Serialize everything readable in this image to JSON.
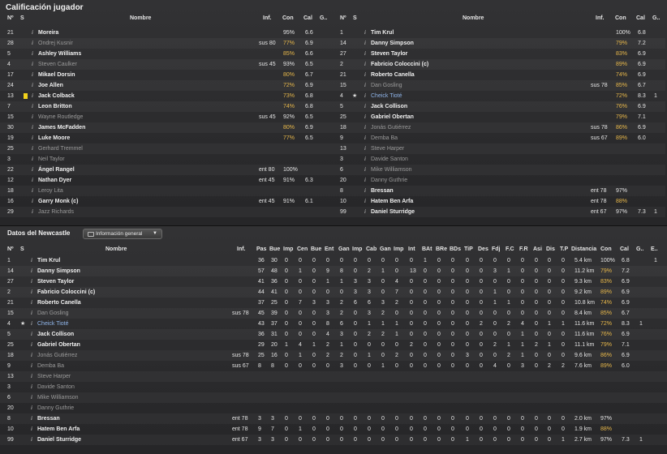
{
  "ratings": {
    "title": "Calificación jugador",
    "headers": {
      "num": "Nº",
      "s": "S",
      "name": "Nombre",
      "inf": "Inf.",
      "con": "Con",
      "cal": "Cal",
      "g": "G.."
    },
    "left": [
      {
        "n": "21",
        "name": "Moreira",
        "style": "normal",
        "inf": "",
        "con": "95%",
        "conc": "wht",
        "cal": "6.6"
      },
      {
        "n": "28",
        "name": "Ondrej Kusnir",
        "style": "dim",
        "inf": "sus 80",
        "con": "77%",
        "conc": "gold",
        "cal": "6.9"
      },
      {
        "n": "5",
        "name": "Ashley Williams",
        "style": "normal",
        "inf": "",
        "con": "85%",
        "conc": "gold",
        "cal": "6.6"
      },
      {
        "n": "4",
        "name": "Steven Caulker",
        "style": "dim",
        "inf": "sus 45",
        "con": "93%",
        "conc": "wht",
        "cal": "6.5"
      },
      {
        "n": "17",
        "name": "Mikael Dorsin",
        "style": "normal",
        "inf": "",
        "con": "80%",
        "conc": "gold",
        "cal": "6.7"
      },
      {
        "n": "24",
        "name": "Joe Allen",
        "style": "normal",
        "inf": "",
        "con": "72%",
        "conc": "gold",
        "cal": "6.9"
      },
      {
        "n": "13",
        "name": "Jack Colback",
        "style": "normal",
        "inf": "",
        "con": "73%",
        "conc": "gold",
        "cal": "6.8",
        "card": true
      },
      {
        "n": "7",
        "name": "Leon Britton",
        "style": "normal",
        "inf": "",
        "con": "74%",
        "conc": "gold",
        "cal": "6.8"
      },
      {
        "n": "15",
        "name": "Wayne Routledge",
        "style": "dim",
        "inf": "sus 45",
        "con": "92%",
        "conc": "wht",
        "cal": "6.5"
      },
      {
        "n": "30",
        "name": "James McFadden",
        "style": "normal",
        "inf": "",
        "con": "80%",
        "conc": "gold",
        "cal": "6.9"
      },
      {
        "n": "19",
        "name": "Luke Moore",
        "style": "normal",
        "inf": "",
        "con": "77%",
        "conc": "gold",
        "cal": "6.5"
      },
      {
        "n": "25",
        "name": "Gerhard Tremmel",
        "style": "dim",
        "inf": "",
        "con": "",
        "conc": "wht",
        "cal": ""
      },
      {
        "n": "3",
        "name": "Neil Taylor",
        "style": "dim",
        "inf": "",
        "con": "",
        "conc": "wht",
        "cal": ""
      },
      {
        "n": "22",
        "name": "Ángel Rangel",
        "style": "normal",
        "inf": "ent 80",
        "con": "100%",
        "conc": "wht",
        "cal": ""
      },
      {
        "n": "12",
        "name": "Nathan Dyer",
        "style": "normal",
        "inf": "ent 45",
        "con": "91%",
        "conc": "wht",
        "cal": "6.3"
      },
      {
        "n": "18",
        "name": "Leroy Lita",
        "style": "dim",
        "inf": "",
        "con": "",
        "conc": "wht",
        "cal": ""
      },
      {
        "n": "16",
        "name": "Garry Monk (c)",
        "style": "normal",
        "inf": "ent 45",
        "con": "91%",
        "conc": "wht",
        "cal": "6.1"
      },
      {
        "n": "29",
        "name": "Jazz Richards",
        "style": "dim",
        "inf": "",
        "con": "",
        "conc": "wht",
        "cal": ""
      }
    ],
    "right": [
      {
        "n": "1",
        "name": "Tim Krul",
        "style": "normal",
        "inf": "",
        "con": "100%",
        "conc": "wht",
        "cal": "6.8",
        "g": ""
      },
      {
        "n": "14",
        "name": "Danny Simpson",
        "style": "normal",
        "inf": "",
        "con": "79%",
        "conc": "gold",
        "cal": "7.2",
        "g": ""
      },
      {
        "n": "27",
        "name": "Steven Taylor",
        "style": "normal",
        "inf": "",
        "con": "83%",
        "conc": "gold",
        "cal": "6.9",
        "g": ""
      },
      {
        "n": "2",
        "name": "Fabricio Coloccini (c)",
        "style": "normal",
        "inf": "",
        "con": "89%",
        "conc": "gold",
        "cal": "6.9",
        "g": ""
      },
      {
        "n": "21",
        "name": "Roberto Canella",
        "style": "normal",
        "inf": "",
        "con": "74%",
        "conc": "gold",
        "cal": "6.9",
        "g": ""
      },
      {
        "n": "15",
        "name": "Dan Gosling",
        "style": "dim",
        "inf": "sus 78",
        "con": "85%",
        "conc": "gold",
        "cal": "6.7",
        "g": ""
      },
      {
        "n": "4",
        "name": "Cheick Tioté",
        "style": "blue",
        "inf": "",
        "con": "72%",
        "conc": "gold",
        "cal": "8.3",
        "g": "1",
        "star": true
      },
      {
        "n": "5",
        "name": "Jack Collison",
        "style": "normal",
        "inf": "",
        "con": "76%",
        "conc": "gold",
        "cal": "6.9",
        "g": ""
      },
      {
        "n": "25",
        "name": "Gabriel Obertan",
        "style": "normal",
        "inf": "",
        "con": "79%",
        "conc": "gold",
        "cal": "7.1",
        "g": ""
      },
      {
        "n": "18",
        "name": "Jonás Gutiérrez",
        "style": "dim",
        "inf": "sus 78",
        "con": "86%",
        "conc": "gold",
        "cal": "6.9",
        "g": ""
      },
      {
        "n": "9",
        "name": "Demba Ba",
        "style": "dim",
        "inf": "sus 67",
        "con": "89%",
        "conc": "gold",
        "cal": "6.0",
        "g": ""
      },
      {
        "n": "13",
        "name": "Steve Harper",
        "style": "dim",
        "inf": "",
        "con": "",
        "conc": "wht",
        "cal": "",
        "g": ""
      },
      {
        "n": "3",
        "name": "Davide Santon",
        "style": "dim",
        "inf": "",
        "con": "",
        "conc": "wht",
        "cal": "",
        "g": ""
      },
      {
        "n": "6",
        "name": "Mike Williamson",
        "style": "dim",
        "inf": "",
        "con": "",
        "conc": "wht",
        "cal": "",
        "g": ""
      },
      {
        "n": "20",
        "name": "Danny Guthrie",
        "style": "dim",
        "inf": "",
        "con": "",
        "conc": "wht",
        "cal": "",
        "g": ""
      },
      {
        "n": "8",
        "name": "Bressan",
        "style": "normal",
        "inf": "ent 78",
        "con": "97%",
        "conc": "wht",
        "cal": "",
        "g": ""
      },
      {
        "n": "10",
        "name": "Hatem Ben Arfa",
        "style": "normal",
        "inf": "ent 78",
        "con": "88%",
        "conc": "gold",
        "cal": "",
        "g": ""
      },
      {
        "n": "99",
        "name": "Daniel Sturridge",
        "style": "normal",
        "inf": "ent 67",
        "con": "97%",
        "conc": "wht",
        "cal": "7.3",
        "g": "1"
      }
    ]
  },
  "stats": {
    "title": "Datos del Newcastle",
    "dropdown": "Información general",
    "headers": [
      "Nº",
      "S",
      "Nombre",
      "Inf.",
      "Pas",
      "Bue",
      "Imp",
      "Cen",
      "Bue",
      "Ent",
      "Gan",
      "Imp",
      "Cab",
      "Gan",
      "Imp",
      "Int",
      "BAt",
      "BRe",
      "BDs",
      "TiP",
      "Des",
      "Fdj",
      "F.C",
      "F.R",
      "Asi",
      "Dis",
      "T.P",
      "Distancia",
      "Con",
      "Cal",
      "G..",
      "E.."
    ],
    "rows": [
      {
        "n": "1",
        "name": "Tim Krul",
        "style": "normal",
        "inf": "",
        "v": [
          "36",
          "30",
          "0",
          "0",
          "0",
          "0",
          "0",
          "0",
          "0",
          "0",
          "0",
          "0",
          "1",
          "0",
          "0",
          "0",
          "0",
          "0",
          "0",
          "0",
          "0",
          "0",
          "0"
        ],
        "dist": "5.4 km",
        "con": "100%",
        "conc": "wht",
        "cal": "6.8",
        "g": "",
        "e": "1"
      },
      {
        "n": "14",
        "name": "Danny Simpson",
        "style": "normal",
        "inf": "",
        "v": [
          "57",
          "48",
          "0",
          "1",
          "0",
          "9",
          "8",
          "0",
          "2",
          "1",
          "0",
          "13",
          "0",
          "0",
          "0",
          "0",
          "0",
          "3",
          "1",
          "0",
          "0",
          "0",
          "0"
        ],
        "dist": "11.2 km",
        "con": "79%",
        "conc": "gold",
        "cal": "7.2",
        "g": "",
        "e": ""
      },
      {
        "n": "27",
        "name": "Steven Taylor",
        "style": "normal",
        "inf": "",
        "v": [
          "41",
          "36",
          "0",
          "0",
          "0",
          "1",
          "1",
          "3",
          "3",
          "0",
          "4",
          "0",
          "0",
          "0",
          "0",
          "0",
          "0",
          "0",
          "0",
          "0",
          "0",
          "0",
          "0"
        ],
        "dist": "9.3 km",
        "con": "83%",
        "conc": "gold",
        "cal": "6.9",
        "g": "",
        "e": ""
      },
      {
        "n": "2",
        "name": "Fabricio Coloccini (c)",
        "style": "normal",
        "inf": "",
        "v": [
          "44",
          "41",
          "0",
          "0",
          "0",
          "0",
          "0",
          "3",
          "3",
          "0",
          "7",
          "0",
          "0",
          "0",
          "0",
          "0",
          "0",
          "1",
          "0",
          "0",
          "0",
          "0",
          "0"
        ],
        "dist": "9.2 km",
        "con": "89%",
        "conc": "gold",
        "cal": "6.9",
        "g": "",
        "e": ""
      },
      {
        "n": "21",
        "name": "Roberto Canella",
        "style": "normal",
        "inf": "",
        "v": [
          "37",
          "25",
          "0",
          "7",
          "3",
          "3",
          "2",
          "6",
          "6",
          "3",
          "2",
          "0",
          "0",
          "0",
          "0",
          "0",
          "0",
          "1",
          "1",
          "0",
          "0",
          "0",
          "0"
        ],
        "dist": "10.8 km",
        "con": "74%",
        "conc": "gold",
        "cal": "6.9",
        "g": "",
        "e": ""
      },
      {
        "n": "15",
        "name": "Dan Gosling",
        "style": "dim",
        "inf": "sus 78",
        "v": [
          "45",
          "39",
          "0",
          "0",
          "0",
          "3",
          "2",
          "0",
          "3",
          "2",
          "0",
          "0",
          "0",
          "0",
          "0",
          "0",
          "0",
          "0",
          "0",
          "0",
          "0",
          "0",
          "0"
        ],
        "dist": "8.4 km",
        "con": "85%",
        "conc": "gold",
        "cal": "6.7",
        "g": "",
        "e": ""
      },
      {
        "n": "4",
        "name": "Cheick Tioté",
        "style": "blue",
        "inf": "",
        "v": [
          "43",
          "37",
          "0",
          "0",
          "0",
          "8",
          "6",
          "0",
          "1",
          "1",
          "1",
          "0",
          "0",
          "0",
          "0",
          "0",
          "2",
          "0",
          "2",
          "4",
          "0",
          "1",
          "1"
        ],
        "dist": "11.6 km",
        "con": "72%",
        "conc": "gold",
        "cal": "8.3",
        "g": "1",
        "e": "",
        "star": true
      },
      {
        "n": "5",
        "name": "Jack Collison",
        "style": "normal",
        "inf": "",
        "v": [
          "36",
          "31",
          "0",
          "0",
          "0",
          "4",
          "3",
          "0",
          "2",
          "2",
          "1",
          "0",
          "0",
          "0",
          "0",
          "0",
          "0",
          "0",
          "0",
          "1",
          "0",
          "0",
          "0"
        ],
        "dist": "11.6 km",
        "con": "76%",
        "conc": "gold",
        "cal": "6.9",
        "g": "",
        "e": ""
      },
      {
        "n": "25",
        "name": "Gabriel Obertan",
        "style": "normal",
        "inf": "",
        "v": [
          "29",
          "20",
          "1",
          "4",
          "1",
          "2",
          "1",
          "0",
          "0",
          "0",
          "0",
          "2",
          "0",
          "0",
          "0",
          "0",
          "0",
          "2",
          "1",
          "1",
          "2",
          "1",
          "0"
        ],
        "dist": "11.1 km",
        "con": "79%",
        "conc": "gold",
        "cal": "7.1",
        "g": "",
        "e": ""
      },
      {
        "n": "18",
        "name": "Jonás Gutiérrez",
        "style": "dim",
        "inf": "sus 78",
        "v": [
          "25",
          "16",
          "0",
          "1",
          "0",
          "2",
          "2",
          "0",
          "1",
          "0",
          "2",
          "0",
          "0",
          "0",
          "0",
          "3",
          "0",
          "0",
          "2",
          "1",
          "0",
          "0",
          "0"
        ],
        "dist": "9.6 km",
        "con": "86%",
        "conc": "gold",
        "cal": "6.9",
        "g": "",
        "e": ""
      },
      {
        "n": "9",
        "name": "Demba Ba",
        "style": "dim",
        "inf": "sus 67",
        "v": [
          "8",
          "8",
          "0",
          "0",
          "0",
          "0",
          "3",
          "0",
          "0",
          "1",
          "0",
          "0",
          "0",
          "0",
          "0",
          "0",
          "0",
          "4",
          "0",
          "3",
          "0",
          "2",
          "2"
        ],
        "dist": "7.6 km",
        "con": "89%",
        "conc": "gold",
        "cal": "6.0",
        "g": "",
        "e": ""
      },
      {
        "n": "13",
        "name": "Steve Harper",
        "style": "dim",
        "inf": "",
        "v": [],
        "dist": "",
        "con": "",
        "conc": "wht",
        "cal": "",
        "g": "",
        "e": ""
      },
      {
        "n": "3",
        "name": "Davide Santon",
        "style": "dim",
        "inf": "",
        "v": [],
        "dist": "",
        "con": "",
        "conc": "wht",
        "cal": "",
        "g": "",
        "e": ""
      },
      {
        "n": "6",
        "name": "Mike Williamson",
        "style": "dim",
        "inf": "",
        "v": [],
        "dist": "",
        "con": "",
        "conc": "wht",
        "cal": "",
        "g": "",
        "e": ""
      },
      {
        "n": "20",
        "name": "Danny Guthrie",
        "style": "dim",
        "inf": "",
        "v": [],
        "dist": "",
        "con": "",
        "conc": "wht",
        "cal": "",
        "g": "",
        "e": ""
      },
      {
        "n": "8",
        "name": "Bressan",
        "style": "normal",
        "inf": "ent 78",
        "v": [
          "3",
          "3",
          "0",
          "0",
          "0",
          "0",
          "0",
          "0",
          "0",
          "0",
          "0",
          "0",
          "0",
          "0",
          "0",
          "0",
          "0",
          "0",
          "0",
          "0",
          "0",
          "0",
          "0"
        ],
        "dist": "2.0 km",
        "con": "97%",
        "conc": "wht",
        "cal": "",
        "g": "",
        "e": ""
      },
      {
        "n": "10",
        "name": "Hatem Ben Arfa",
        "style": "normal",
        "inf": "ent 78",
        "v": [
          "9",
          "7",
          "0",
          "1",
          "0",
          "0",
          "0",
          "0",
          "0",
          "0",
          "0",
          "0",
          "0",
          "0",
          "0",
          "0",
          "0",
          "0",
          "0",
          "0",
          "0",
          "0",
          "0"
        ],
        "dist": "1.9 km",
        "con": "88%",
        "conc": "gold",
        "cal": "",
        "g": "",
        "e": ""
      },
      {
        "n": "99",
        "name": "Daniel Sturridge",
        "style": "normal",
        "inf": "ent 67",
        "v": [
          "3",
          "3",
          "0",
          "0",
          "0",
          "0",
          "0",
          "0",
          "0",
          "0",
          "0",
          "0",
          "0",
          "0",
          "0",
          "1",
          "0",
          "0",
          "0",
          "0",
          "0",
          "0",
          "1"
        ],
        "dist": "2.7 km",
        "con": "97%",
        "conc": "wht",
        "cal": "7.3",
        "g": "1",
        "e": ""
      }
    ]
  },
  "colors": {
    "gold": "#e8b84a",
    "blue": "#8fb4e8",
    "card": "#f2d21b"
  }
}
